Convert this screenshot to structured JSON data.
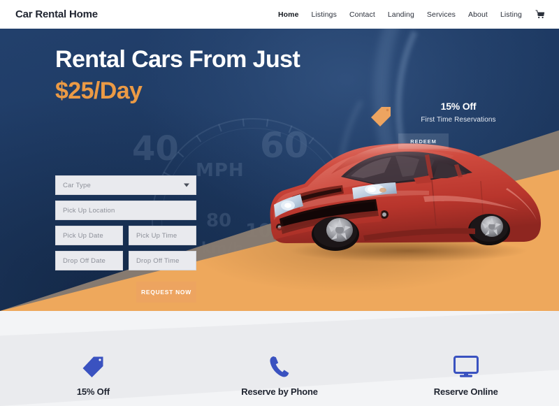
{
  "header": {
    "logo": "Car Rental Home",
    "nav": [
      {
        "label": "Home",
        "active": true
      },
      {
        "label": "Listings",
        "active": false
      },
      {
        "label": "Contact",
        "active": false
      },
      {
        "label": "Landing",
        "active": false
      },
      {
        "label": "Services",
        "active": false
      },
      {
        "label": "About",
        "active": false
      },
      {
        "label": "Listing",
        "active": false
      }
    ],
    "cart_icon": "shopping-cart-icon"
  },
  "hero": {
    "headline_line1": "Rental Cars From Just",
    "headline_line2": "$25/Day",
    "background_art": {
      "type": "speedometer-graphic",
      "labels": [
        "40",
        "60",
        "MPH",
        "80",
        "100",
        "km/h"
      ]
    },
    "vehicle_image": "red-sedan-car"
  },
  "booking_form": {
    "car_type": {
      "placeholder": "Car Type",
      "value": "",
      "icon": "chevron-down-icon"
    },
    "pick_up_location": {
      "placeholder": "Pick Up Location",
      "value": ""
    },
    "pick_up_date": {
      "placeholder": "Pick Up Date",
      "value": ""
    },
    "pick_up_time": {
      "placeholder": "Pick Up Time",
      "value": ""
    },
    "drop_off_date": {
      "placeholder": "Drop Off Date",
      "value": ""
    },
    "drop_off_time": {
      "placeholder": "Drop Off Time",
      "value": ""
    },
    "submit_label": "REQUEST NOW"
  },
  "promo": {
    "icon": "price-tag-icon",
    "title": "15% Off",
    "subtitle": "First Time Reservations",
    "button_label": "REDEEM"
  },
  "features": [
    {
      "icon": "price-tag-icon",
      "title": "15% Off"
    },
    {
      "icon": "phone-icon",
      "title": "Reserve by Phone"
    },
    {
      "icon": "desktop-monitor-icon",
      "title": "Reserve Online"
    }
  ],
  "colors": {
    "navy": "#1e3a63",
    "orange": "#eb9a45",
    "road_orange": "#eea85c",
    "button_orange": "#eda460",
    "icon_blue": "#3a52c0",
    "light_bg": "#f3f4f6",
    "field_bg": "#e9eaee",
    "text_dark": "#1f2430"
  }
}
